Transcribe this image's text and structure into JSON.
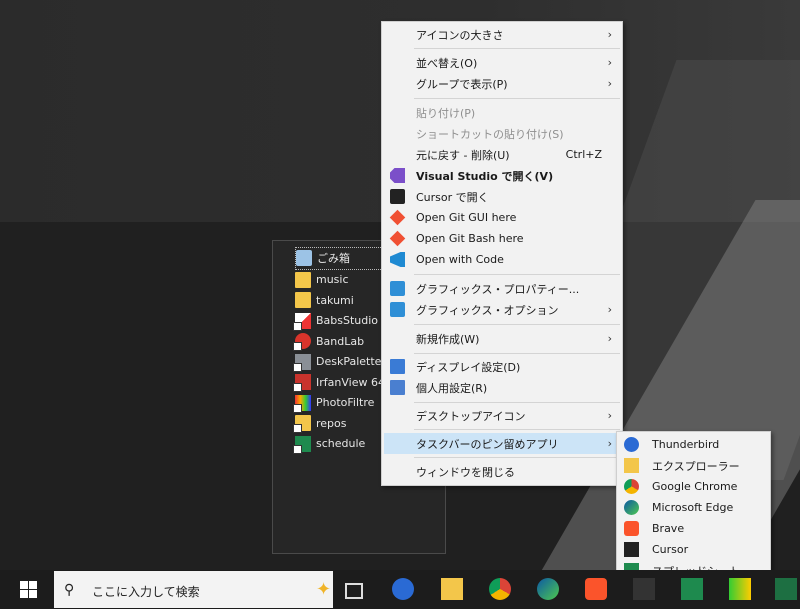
{
  "desktop_icons": [
    {
      "label": "ごみ箱",
      "icon": "recycle-bin-icon",
      "selected": true
    },
    {
      "label": "music",
      "icon": "folder-icon"
    },
    {
      "label": "takumi",
      "icon": "folder-icon"
    },
    {
      "label": "BabsStudio",
      "icon": "babsstudio-icon"
    },
    {
      "label": "BandLab",
      "icon": "bandlab-icon"
    },
    {
      "label": "DeskPalette",
      "icon": "deskpalette-icon"
    },
    {
      "label": "IrfanView 64",
      "icon": "irfanview-icon"
    },
    {
      "label": "PhotoFiltre",
      "icon": "photofiltre-icon"
    },
    {
      "label": "repos",
      "icon": "folder-icon"
    },
    {
      "label": "schedule",
      "icon": "spreadsheet-icon"
    }
  ],
  "context_menu": {
    "items": [
      {
        "label": "アイコンの大きさ",
        "submenu": true
      },
      {
        "label": "並べ替え(O)",
        "submenu": true
      },
      {
        "label": "グループで表示(P)",
        "submenu": true
      },
      {
        "label": "貼り付け(P)",
        "disabled": true
      },
      {
        "label": "ショートカットの貼り付け(S)",
        "disabled": true
      },
      {
        "label": "元に戻す - 削除(U)",
        "shortcut": "Ctrl+Z"
      },
      {
        "label": "Visual Studio で開く(V)",
        "icon": "visual-studio-icon",
        "bold": true
      },
      {
        "label": "Cursor で開く",
        "icon": "cursor-icon"
      },
      {
        "label": "Open Git GUI here",
        "icon": "git-icon"
      },
      {
        "label": "Open Git Bash here",
        "icon": "git-icon"
      },
      {
        "label": "Open with Code",
        "icon": "vscode-icon"
      },
      {
        "label": "グラフィックス・プロパティー...",
        "icon": "graphics-icon"
      },
      {
        "label": "グラフィックス・オプション",
        "icon": "graphics-icon",
        "submenu": true
      },
      {
        "label": "新規作成(W)",
        "submenu": true
      },
      {
        "label": "ディスプレイ設定(D)",
        "icon": "display-settings-icon"
      },
      {
        "label": "個人用設定(R)",
        "icon": "personalize-icon"
      },
      {
        "label": "デスクトップアイコン",
        "submenu": true
      },
      {
        "label": "タスクバーのピン留めアプリ",
        "submenu": true,
        "highlighted": true
      },
      {
        "label": "ウィンドウを閉じる"
      }
    ]
  },
  "submenu": {
    "items": [
      {
        "label": "Thunderbird",
        "icon": "thunderbird-icon"
      },
      {
        "label": "エクスプローラー",
        "icon": "explorer-icon"
      },
      {
        "label": "Google Chrome",
        "icon": "chrome-icon"
      },
      {
        "label": "Microsoft Edge",
        "icon": "edge-icon"
      },
      {
        "label": "Brave",
        "icon": "brave-icon"
      },
      {
        "label": "Cursor",
        "icon": "cursor-icon"
      },
      {
        "label": "スプレッドシート",
        "icon": "spreadsheet-icon"
      }
    ]
  },
  "taskbar": {
    "search_placeholder": "ここに入力して検索",
    "chevron": "›",
    "apps": [
      "task-view",
      "thunderbird",
      "explorer",
      "chrome",
      "edge",
      "brave",
      "cursor",
      "spreadsheet",
      "deskpalette",
      "excel"
    ]
  },
  "colors": {
    "highlight": "#cce4f7",
    "menu_bg": "#f2f2f2",
    "taskbar": "#1c1c1c"
  }
}
